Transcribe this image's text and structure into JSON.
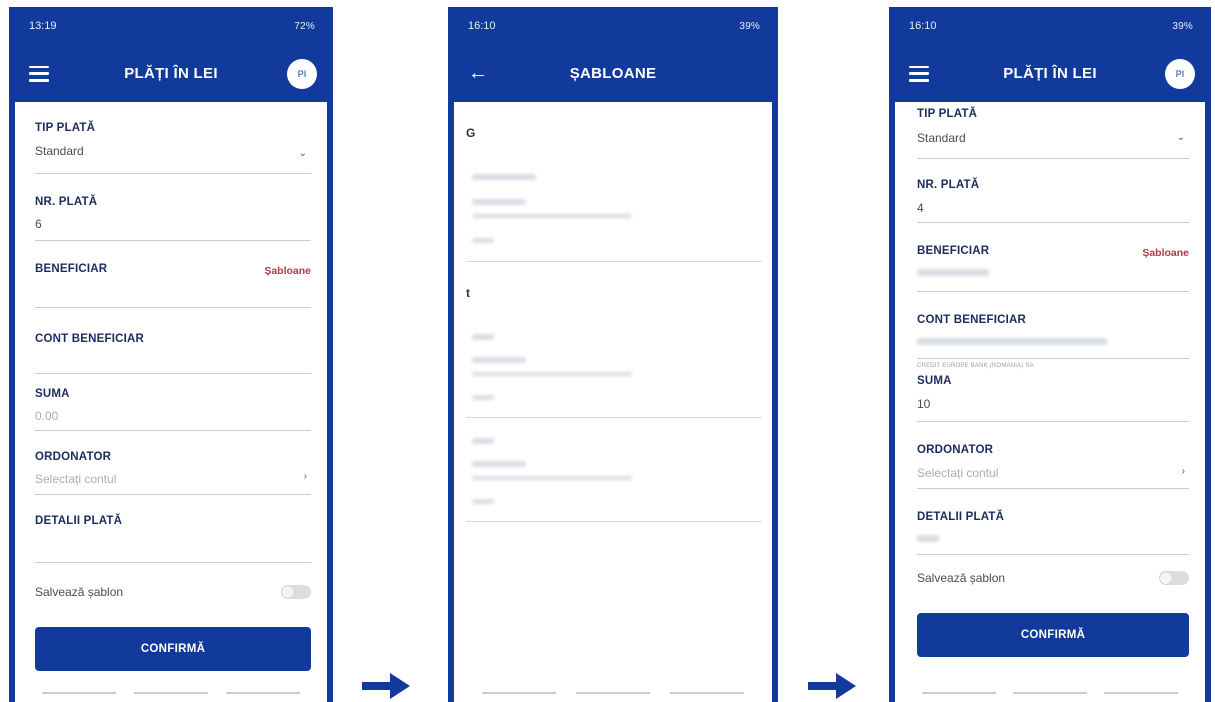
{
  "screens": [
    {
      "status_time": "13:19",
      "status_right": "72%",
      "title": "PLĂȚI ÎN LEI",
      "avatar": "PI",
      "fields": {
        "tip_label": "TIP PLATĂ",
        "tip_value": "Standard",
        "nr_label": "NR. PLATĂ",
        "nr_value": "6",
        "ben_label": "BENEFICIAR",
        "ben_link": "Șabloane",
        "cont_label": "CONT BENEFICIAR",
        "suma_label": "SUMA",
        "suma_placeholder": "0.00",
        "ord_label": "ORDONATOR",
        "ord_placeholder": "Selectați contul",
        "det_label": "DETALII PLATĂ",
        "save_label": "Salvează șablon",
        "confirm_label": "CONFIRMĂ"
      }
    },
    {
      "status_time": "16:10",
      "status_right": "39%",
      "title": "ȘABLOANE",
      "sections": [
        "G",
        "t"
      ]
    },
    {
      "status_time": "16:10",
      "status_right": "39%",
      "title": "PLĂȚI ÎN LEI",
      "avatar": "PI",
      "fields": {
        "tip_label": "TIP PLATĂ",
        "tip_value": "Standard",
        "nr_label": "NR. PLATĂ",
        "nr_value": "4",
        "ben_label": "BENEFICIAR",
        "ben_link": "Șabloane",
        "cont_label": "CONT BENEFICIAR",
        "cont_hint": "CREDIT EUROPE BANK (ROMANIA) SA",
        "suma_label": "SUMA",
        "suma_value": "10",
        "ord_label": "ORDONATOR",
        "ord_placeholder": "Selectați contul",
        "det_label": "DETALII PLATĂ",
        "save_label": "Salvează șablon",
        "confirm_label": "CONFIRMĂ"
      }
    }
  ],
  "colors": {
    "brand": "#123a9c",
    "link": "#b03a44"
  },
  "icons": [
    "menu-icon",
    "back-arrow-icon",
    "chevron-down-icon",
    "chevron-right-icon",
    "flow-arrow-icon"
  ]
}
